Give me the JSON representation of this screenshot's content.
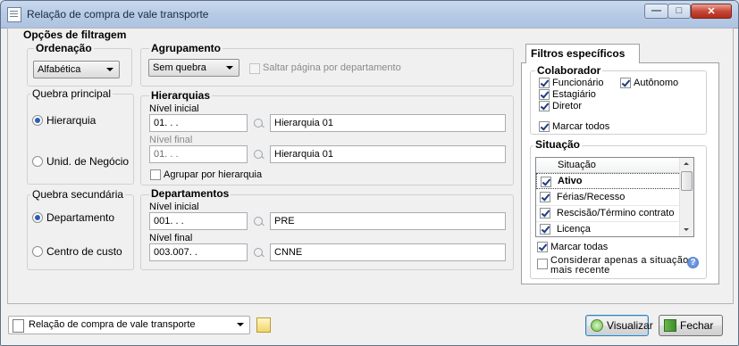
{
  "window": {
    "title": "Relação de compra de vale transporte",
    "controls": {
      "minimize": "—",
      "maximize": "□",
      "close": "✕"
    }
  },
  "filtragem": {
    "title": "Opções de filtragem",
    "ordenacao": {
      "title": "Ordenação",
      "selected": "Alfabética"
    },
    "agrupamento": {
      "title": "Agrupamento",
      "selected": "Sem quebra",
      "saltar_label": "Saltar página por departamento",
      "saltar_checked": false
    },
    "quebra_principal": {
      "title": "Quebra principal",
      "options": [
        "Hierarquia",
        "Unid. de Negócio"
      ],
      "selected": "Hierarquia"
    },
    "hierarquias": {
      "title": "Hierarquias",
      "nivel_inicial_label": "Nível inicial",
      "nivel_inicial_code": "01.    .    .",
      "nivel_inicial_desc": "Hierarquia 01",
      "nivel_final_label": "Nível final",
      "nivel_final_code": "01.    .    .",
      "nivel_final_desc": "Hierarquia 01",
      "agrupar_label": "Agrupar por hierarquia",
      "agrupar_checked": false
    },
    "quebra_secundaria": {
      "title": "Quebra secundária",
      "options": [
        "Departamento",
        "Centro de custo"
      ],
      "selected": "Departamento"
    },
    "departamentos": {
      "title": "Departamentos",
      "nivel_inicial_label": "Nível inicial",
      "nivel_inicial_code": "001.    .    .",
      "nivel_inicial_desc": "PRE",
      "nivel_final_label": "Nível final",
      "nivel_final_code": "003.007.    .",
      "nivel_final_desc": "CNNE"
    }
  },
  "filtros": {
    "tab_label": "Filtros específicos",
    "colaborador": {
      "title": "Colaborador",
      "items": [
        {
          "label": "Funcionário",
          "checked": true
        },
        {
          "label": "Autônomo",
          "checked": true
        },
        {
          "label": "Estagiário",
          "checked": true
        },
        {
          "label": "Diretor",
          "checked": true
        }
      ],
      "marcar_todos_label": "Marcar todos",
      "marcar_todos_checked": true
    },
    "situacao": {
      "title": "Situação",
      "column_header": "Situação",
      "rows": [
        {
          "label": "Ativo",
          "checked": true
        },
        {
          "label": "Férias/Recesso",
          "checked": true
        },
        {
          "label": "Rescisão/Término contrato",
          "checked": true
        },
        {
          "label": "Licença",
          "checked": true
        }
      ],
      "marcar_todas_label": "Marcar todas",
      "marcar_todas_checked": true,
      "considerar_line1": "Considerar apenas a situação",
      "considerar_line2": "mais recente",
      "considerar_checked": false,
      "help_glyph": "?"
    }
  },
  "footer": {
    "report_selected": "Relação de compra de vale transporte",
    "visualizar_label": "Visualizar",
    "fechar_label": "Fechar"
  }
}
